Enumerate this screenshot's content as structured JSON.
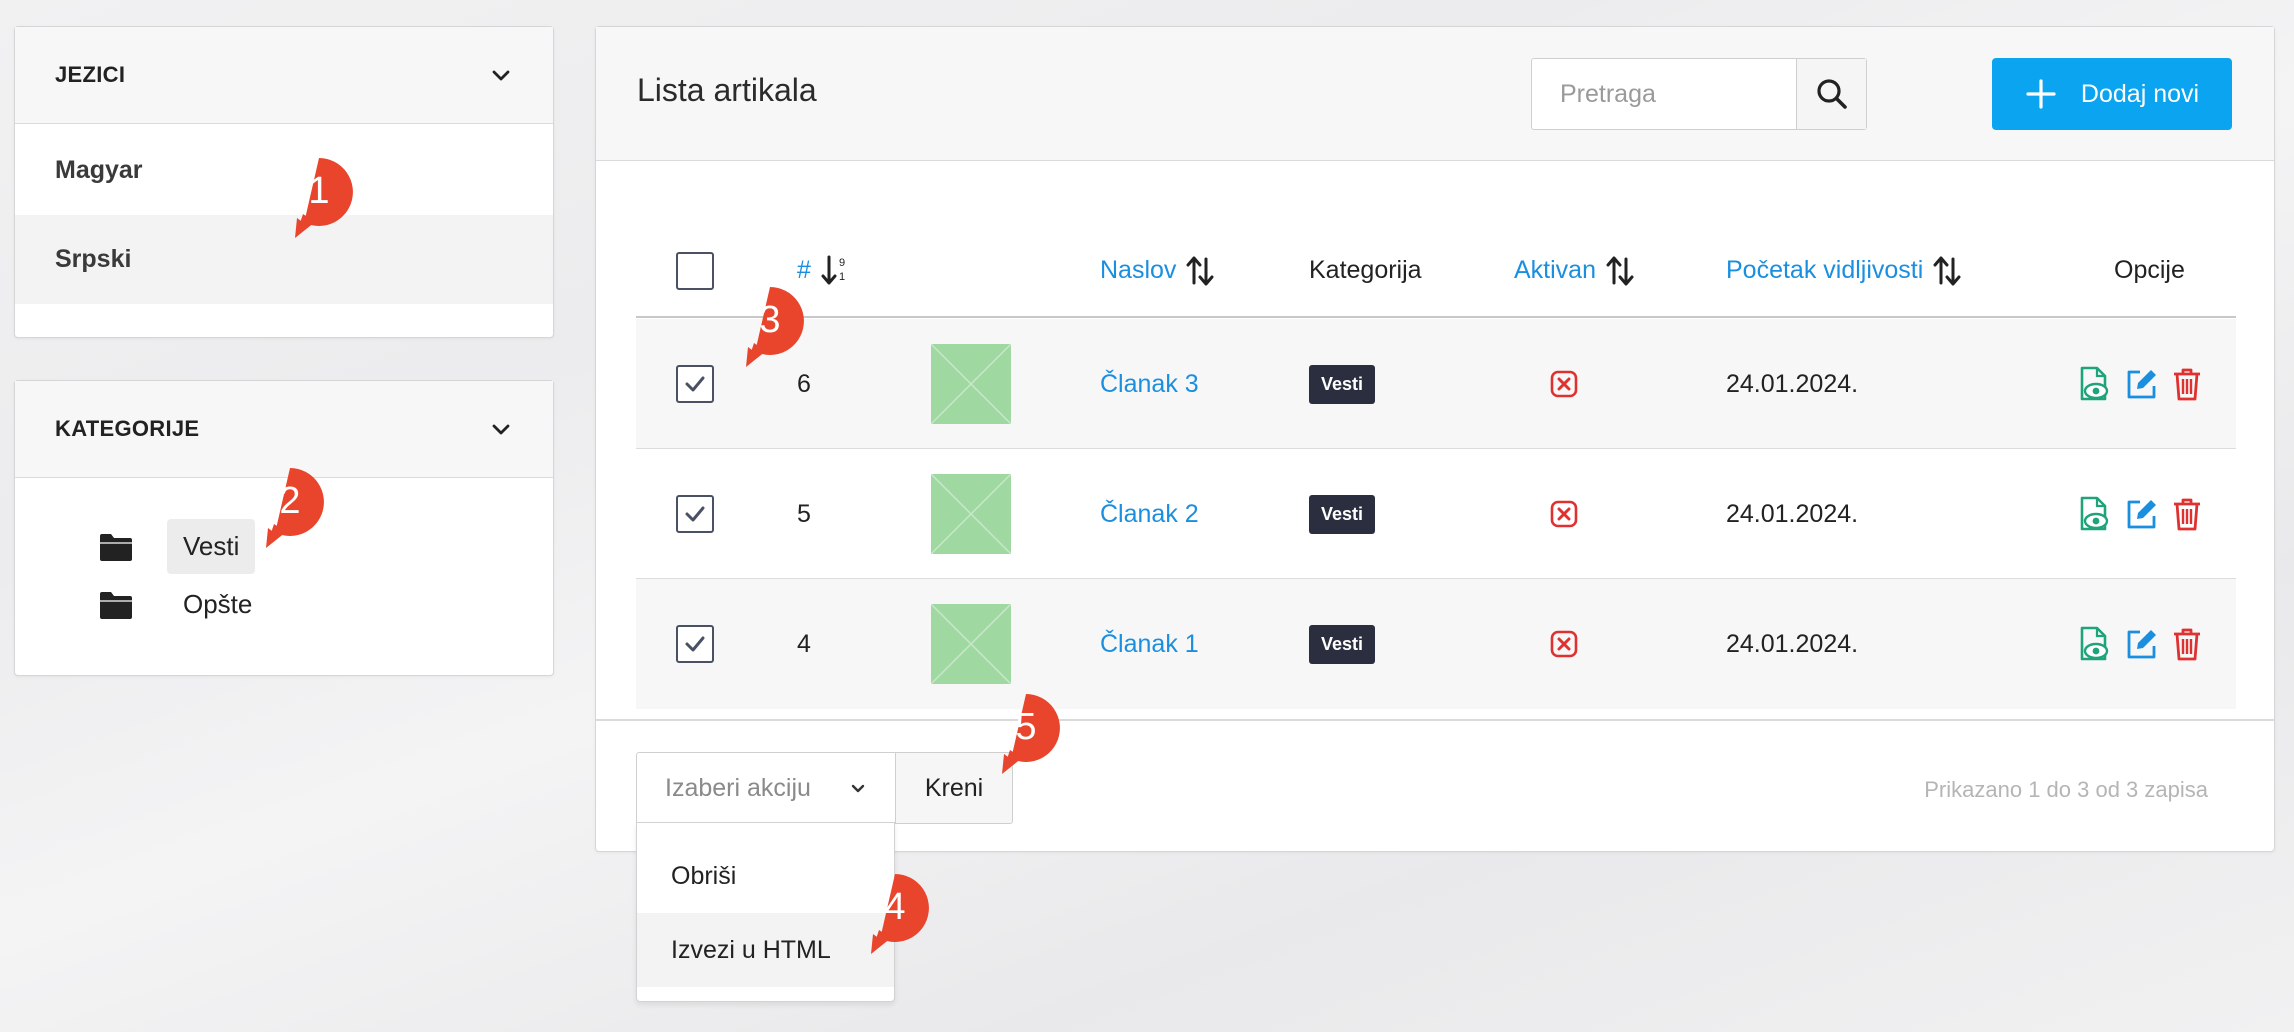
{
  "languages": {
    "title": "JEZICI",
    "items": [
      "Magyar",
      "Srpski"
    ],
    "active": "Srpski"
  },
  "categories": {
    "title": "KATEGORIJE",
    "items": [
      "Vesti",
      "Opšte"
    ],
    "selected": "Vesti"
  },
  "main": {
    "title": "Lista artikala",
    "search_placeholder": "Pretraga",
    "add_label": "Dodaj novi"
  },
  "table": {
    "headers": {
      "id": "#",
      "title": "Naslov",
      "category": "Kategorija",
      "active": "Aktivan",
      "visibility_start": "Početak vidljivosti",
      "options": "Opcije"
    },
    "rows": [
      {
        "id": "6",
        "title": "Članak 3",
        "category": "Vesti",
        "active": false,
        "date": "24.01.2024.",
        "checked": true
      },
      {
        "id": "5",
        "title": "Članak 2",
        "category": "Vesti",
        "active": false,
        "date": "24.01.2024.",
        "checked": true
      },
      {
        "id": "4",
        "title": "Članak 1",
        "category": "Vesti",
        "active": false,
        "date": "24.01.2024.",
        "checked": true
      }
    ]
  },
  "footer": {
    "select_placeholder": "Izaberi akciju",
    "go_label": "Kreni",
    "shown_info": "Prikazano 1 do 3 od 3 zapisa"
  },
  "action_menu": {
    "items": [
      "Obriši",
      "Izvezi u HTML"
    ],
    "hovered": "Izvezi u HTML"
  },
  "markers": [
    "1",
    "2",
    "3",
    "4",
    "5"
  ],
  "colors": {
    "primary": "#0ba4f0",
    "link": "#1a8fe0",
    "marker": "#e8452c",
    "danger": "#e03131",
    "view": "#1fa37a",
    "badge": "#2a2e3e"
  }
}
